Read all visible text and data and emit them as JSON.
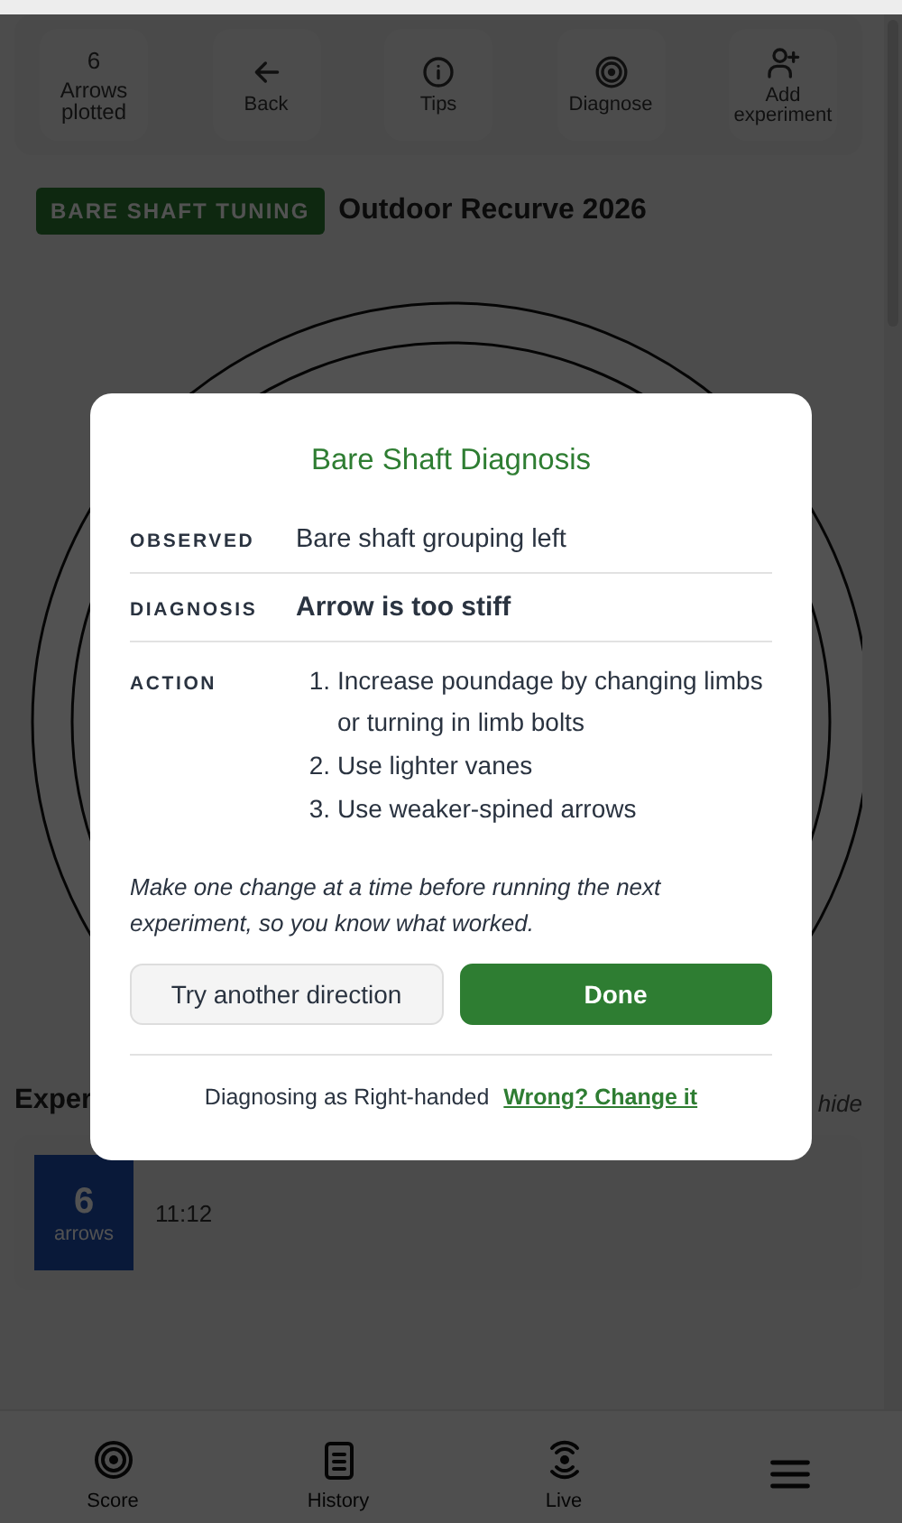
{
  "toolbar": {
    "count": "6",
    "count_label": "Arrows plotted",
    "buttons": [
      {
        "label": "Back"
      },
      {
        "label": "Tips"
      },
      {
        "label": "Diagnose"
      },
      {
        "label": "Add experiment"
      }
    ]
  },
  "header": {
    "badge": "BARE SHAFT TUNING",
    "title": "Outdoor Recurve 2026"
  },
  "experiments": {
    "heading": "Exper",
    "hint": "hide",
    "items": [
      {
        "count": "6",
        "unit": "arrows",
        "time": "11:12"
      }
    ]
  },
  "nav": [
    {
      "label": "Score"
    },
    {
      "label": "History"
    },
    {
      "label": "Live"
    }
  ],
  "dialog": {
    "title": "Bare Shaft Diagnosis",
    "rows": [
      {
        "label": "OBSERVED",
        "kind": "text",
        "value": "Bare shaft grouping left"
      },
      {
        "label": "DIAGNOSIS",
        "kind": "emphasis",
        "value": "Arrow is too stiff"
      },
      {
        "label": "ACTION",
        "kind": "steps",
        "steps": [
          {
            "number": "1.",
            "text": "Increase poundage by changing limbs or turning in limb bolts"
          },
          {
            "number": "2.",
            "text": "Use lighter vanes"
          },
          {
            "number": "3.",
            "text": "Use weaker-spined arrows"
          }
        ]
      }
    ],
    "note": "Make one change at a time before running the next experiment, so you know what worked.",
    "buttons": [
      {
        "label": "Try another direction",
        "kind": "secondary"
      },
      {
        "label": "Done",
        "kind": "primary"
      }
    ],
    "footer": {
      "text": "Diagnosing as Right-handed",
      "link": "Wrong? Change it"
    }
  }
}
